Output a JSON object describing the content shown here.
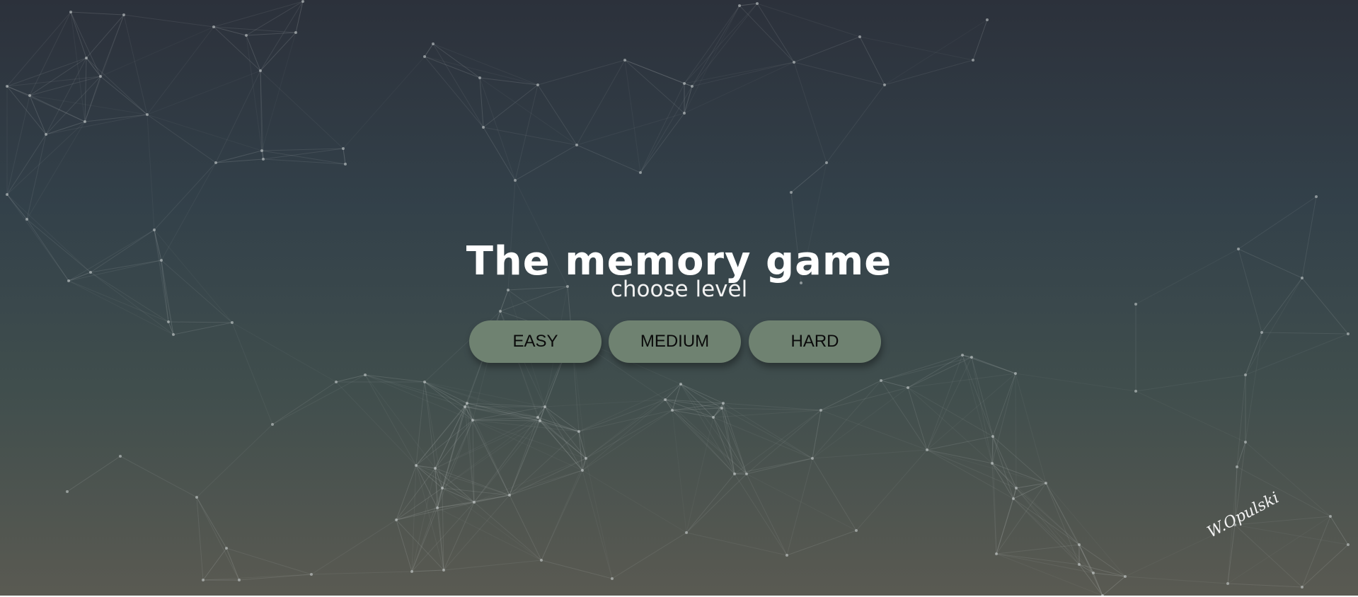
{
  "app": {
    "title": "The memory game",
    "subtitle": "choose level"
  },
  "levels": [
    {
      "label": "EASY"
    },
    {
      "label": "MEDIUM"
    },
    {
      "label": "HARD"
    }
  ],
  "signature": "W.Opulski",
  "colors": {
    "background_top": "#2c313b",
    "background_bottom": "#5a5a52",
    "button_fill": "#6f8271",
    "button_text": "#0a0a0a",
    "title_text": "#ffffff",
    "network_lines": "#d2d7d7"
  }
}
